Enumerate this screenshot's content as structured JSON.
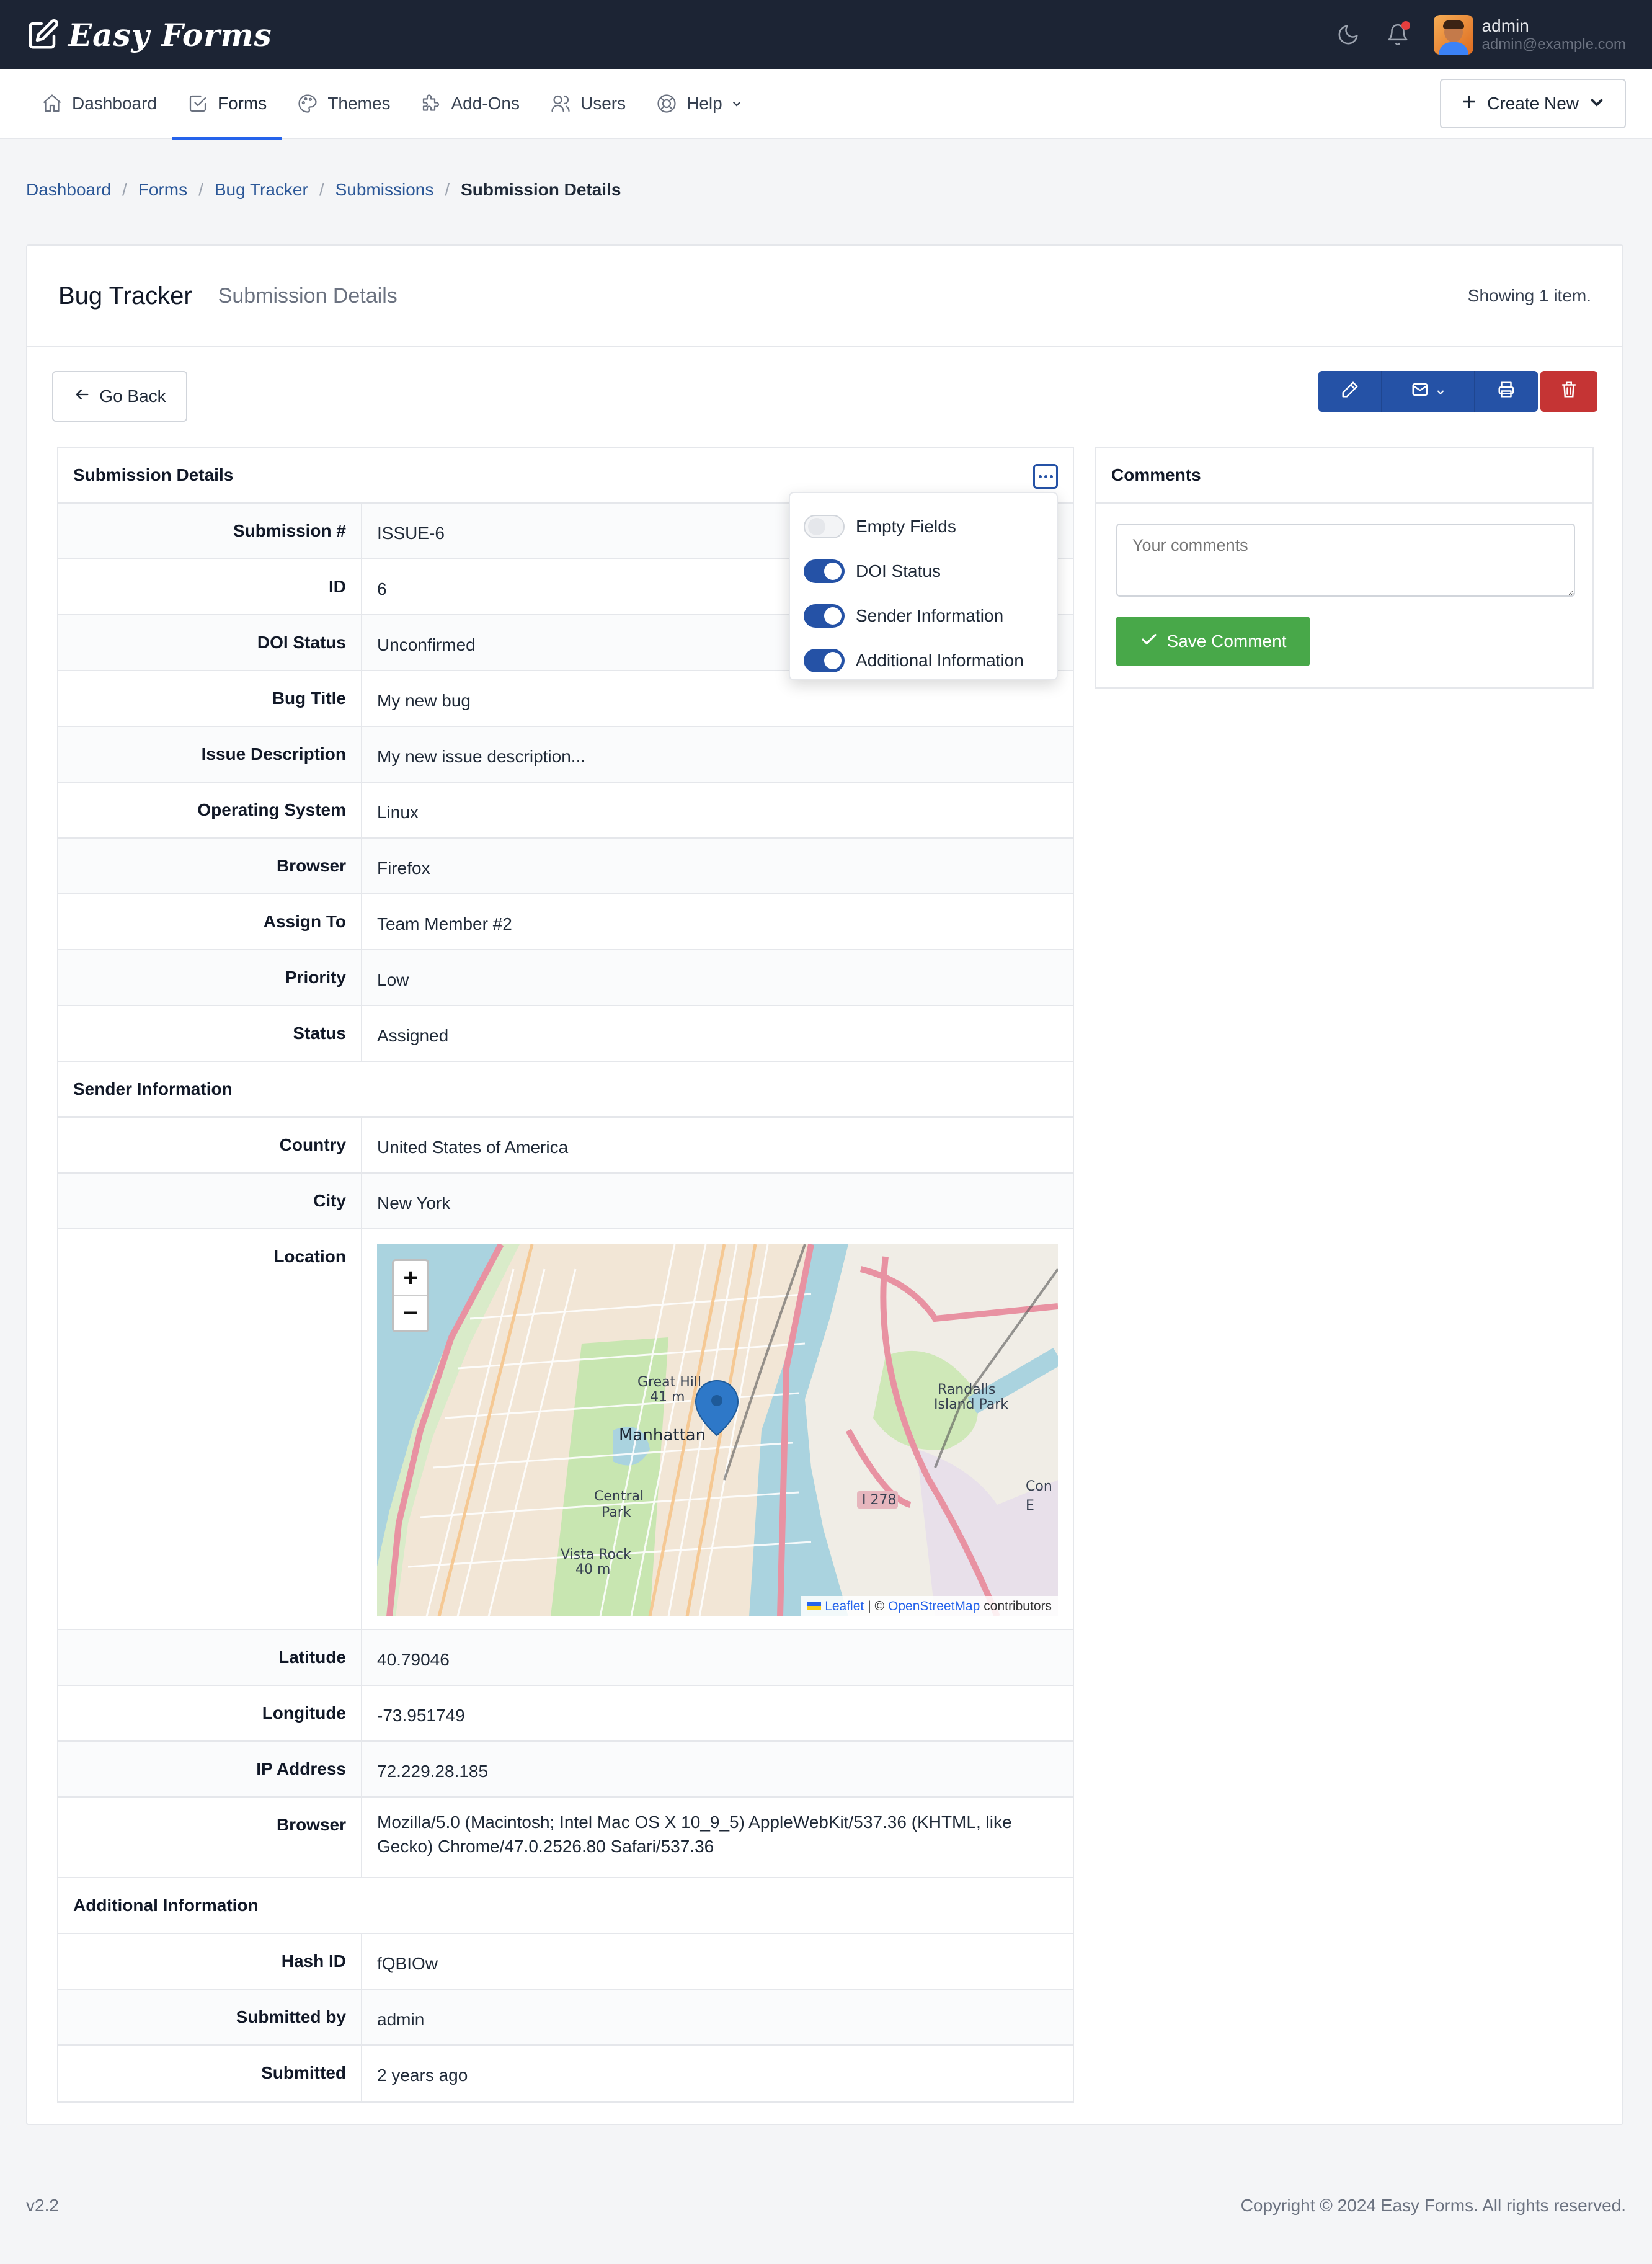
{
  "app": {
    "brand": "Easy Forms"
  },
  "user": {
    "name": "admin",
    "email": "admin@example.com"
  },
  "nav": {
    "items": [
      {
        "label": "Dashboard",
        "icon": "home-icon"
      },
      {
        "label": "Forms",
        "icon": "forms-icon",
        "active": true
      },
      {
        "label": "Themes",
        "icon": "palette-icon"
      },
      {
        "label": "Add-Ons",
        "icon": "puzzle-icon"
      },
      {
        "label": "Users",
        "icon": "users-icon"
      },
      {
        "label": "Help",
        "icon": "lifebuoy-icon"
      }
    ],
    "create_label": "Create New"
  },
  "breadcrumb": {
    "items": [
      "Dashboard",
      "Forms",
      "Bug Tracker",
      "Submissions"
    ],
    "current": "Submission Details"
  },
  "card": {
    "title": "Bug Tracker",
    "subtitle": "Submission Details",
    "summary": "Showing 1 item.",
    "go_back": "Go Back"
  },
  "details": {
    "heading": "Submission Details",
    "fields": [
      {
        "label": "Submission #",
        "value": "ISSUE-6"
      },
      {
        "label": "ID",
        "value": "6"
      },
      {
        "label": "DOI Status",
        "value": "Unconfirmed"
      },
      {
        "label": "Bug Title",
        "value": "My new bug"
      },
      {
        "label": "Issue Description",
        "value": "My new issue description..."
      },
      {
        "label": "Operating System",
        "value": "Linux"
      },
      {
        "label": "Browser",
        "value": "Firefox"
      },
      {
        "label": "Assign To",
        "value": "Team Member #2"
      },
      {
        "label": "Priority",
        "value": "Low"
      },
      {
        "label": "Status",
        "value": "Assigned"
      }
    ],
    "sender_heading": "Sender Information",
    "sender": {
      "country_label": "Country",
      "country": "United States of America",
      "city_label": "City",
      "city": "New York",
      "location_label": "Location",
      "latitude_label": "Latitude",
      "latitude": "40.79046",
      "longitude_label": "Longitude",
      "longitude": "-73.951749",
      "ip_label": "IP Address",
      "ip": "72.229.28.185",
      "browser_label": "Browser",
      "browser": "Mozilla/5.0 (Macintosh; Intel Mac OS X 10_9_5) AppleWebKit/537.36 (KHTML, like Gecko) Chrome/47.0.2526.80 Safari/537.36"
    },
    "additional_heading": "Additional Information",
    "additional": [
      {
        "label": "Hash ID",
        "value": "fQBIOw"
      },
      {
        "label": "Submitted by",
        "value": "admin"
      },
      {
        "label": "Submitted",
        "value": "2 years ago"
      }
    ]
  },
  "map": {
    "zoom_in": "+",
    "zoom_out": "−",
    "labels": [
      "Great Hill",
      "41 m",
      "Manhattan",
      "Central",
      "Park",
      "Vista Rock",
      "40 m",
      "Randalls",
      "Island Park",
      "I 278",
      "Con E"
    ],
    "attr_leaflet": "Leaflet",
    "attr_sep": "| ©",
    "attr_osm": "OpenStreetMap",
    "attr_contrib": "contributors"
  },
  "popover": {
    "items": [
      {
        "label": "Empty Fields",
        "on": false
      },
      {
        "label": "DOI Status",
        "on": true
      },
      {
        "label": "Sender Information",
        "on": true
      },
      {
        "label": "Additional Information",
        "on": true
      }
    ]
  },
  "comments": {
    "heading": "Comments",
    "placeholder": "Your comments",
    "save_label": "Save Comment"
  },
  "footer": {
    "version": "v2.2",
    "copyright": "Copyright © 2024 Easy Forms. All rights reserved."
  },
  "colors": {
    "primary": "#2552a6",
    "danger": "#c53434",
    "success": "#48a849",
    "topbar": "#1c2434"
  }
}
